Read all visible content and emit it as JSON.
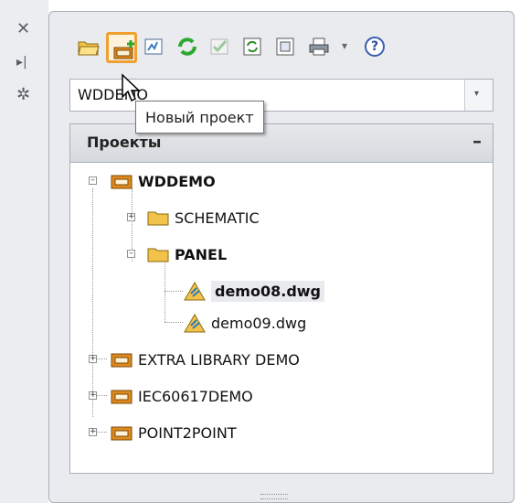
{
  "palette": {
    "strip_icons": [
      "close-icon",
      "auto-hide-icon",
      "properties-icon"
    ],
    "toolbar": {
      "buttons": [
        "open-project-icon",
        "new-project-icon",
        "new-drawing-icon",
        "refresh-icon",
        "check-icon",
        "settings-icon",
        "document-icon",
        "print-icon",
        "more-dropdown-icon",
        "help-icon"
      ],
      "active_button": "new-project-icon",
      "help_symbol": "?",
      "dropdown_symbol": "▾"
    },
    "combo": {
      "value": "WDDEMO"
    },
    "tooltip": {
      "text": "Новый проект"
    },
    "section": {
      "title": "Проекты",
      "collapse_symbol": "–"
    },
    "tree": {
      "items": [
        {
          "label": "WDDEMO",
          "bold": true
        },
        {
          "label": "SCHEMATIC",
          "bold": false
        },
        {
          "label": "PANEL",
          "bold": true
        },
        {
          "label": "demo08.dwg",
          "bold": true,
          "selected": true
        },
        {
          "label": "demo09.dwg",
          "bold": false
        },
        {
          "label": "EXTRA LIBRARY DEMO",
          "bold": false
        },
        {
          "label": "IEC60617DEMO",
          "bold": false
        },
        {
          "label": "POINT2POINT",
          "bold": false
        }
      ]
    },
    "colors": {
      "accent_highlight": "#f0a030",
      "folder": "#f2c34a",
      "project_icon": "#e08a1e"
    }
  }
}
